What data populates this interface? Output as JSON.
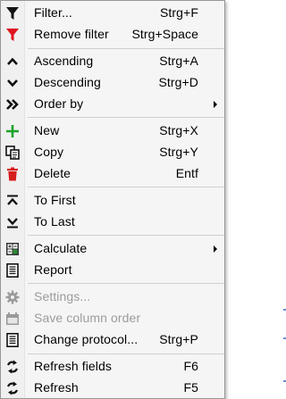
{
  "menu": {
    "items": [
      {
        "label": "Filter...",
        "shortcut": "Strg+F",
        "icon": "filter-icon"
      },
      {
        "label": "Remove filter",
        "shortcut": "Strg+Space",
        "icon": "remove-filter-icon"
      },
      {
        "label": "Ascending",
        "shortcut": "Strg+A",
        "icon": "chevron-up-icon"
      },
      {
        "label": "Descending",
        "shortcut": "Strg+D",
        "icon": "chevron-down-icon"
      },
      {
        "label": "Order by",
        "shortcut": "",
        "icon": "double-chevron-right-icon"
      },
      {
        "label": "New",
        "shortcut": "Strg+X",
        "icon": "plus-icon"
      },
      {
        "label": "Copy",
        "shortcut": "Strg+Y",
        "icon": "copy-icon"
      },
      {
        "label": "Delete",
        "shortcut": "Entf",
        "icon": "trash-icon"
      },
      {
        "label": "To First",
        "shortcut": "",
        "icon": "to-first-icon"
      },
      {
        "label": "To Last",
        "shortcut": "",
        "icon": "to-last-icon"
      },
      {
        "label": "Calculate",
        "shortcut": "",
        "icon": "calculator-icon"
      },
      {
        "label": "Report",
        "shortcut": "",
        "icon": "report-icon"
      },
      {
        "label": "Settings...",
        "shortcut": "",
        "icon": "gear-icon"
      },
      {
        "label": "Save column order",
        "shortcut": "",
        "icon": "save-columns-icon"
      },
      {
        "label": "Change protocol...",
        "shortcut": "Strg+P",
        "icon": "protocol-icon"
      },
      {
        "label": "Refresh fields",
        "shortcut": "F6",
        "icon": "refresh-fields-icon"
      },
      {
        "label": "Refresh",
        "shortcut": "F5",
        "icon": "refresh-icon"
      }
    ]
  },
  "colors": {
    "filter_red": "#e0141e",
    "add_green": "#1aa32a",
    "delete_red": "#d71d1d",
    "disabled_text": "#9c9c9c",
    "separator": "#cfcfcf"
  }
}
